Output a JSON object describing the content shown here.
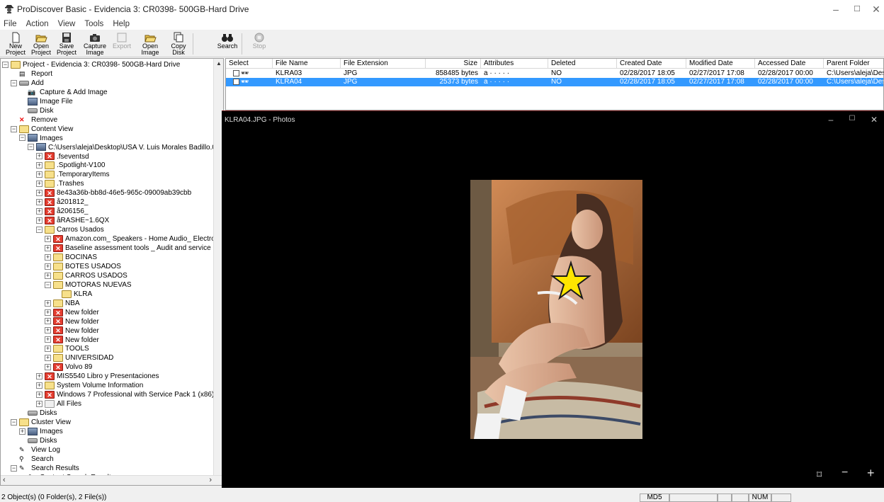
{
  "window": {
    "title": "ProDiscover Basic - Evidencia 3: CR0398- 500GB-Hard Drive",
    "controls": [
      "–",
      "☐",
      "✕"
    ]
  },
  "menu": [
    "File",
    "Action",
    "View",
    "Tools",
    "Help"
  ],
  "toolbar": {
    "buttons": [
      {
        "label": "New\nProject",
        "icon": "new-project-icon",
        "enabled": true
      },
      {
        "label": "Open\nProject",
        "icon": "open-project-icon",
        "enabled": true
      },
      {
        "label": "Save\nProject",
        "icon": "save-project-icon",
        "enabled": true
      },
      {
        "label": "Capture\nImage",
        "icon": "capture-image-icon",
        "enabled": true
      },
      {
        "label": "Export",
        "icon": "export-icon",
        "enabled": false
      },
      {
        "label": "Open\nImage",
        "icon": "open-image-icon",
        "enabled": true
      },
      {
        "label": "Copy\nDisk",
        "icon": "copy-disk-icon",
        "enabled": true
      },
      {
        "label": "Search",
        "icon": "binoculars-icon",
        "enabled": true
      },
      {
        "label": "Stop",
        "icon": "stop-icon",
        "enabled": false
      }
    ]
  },
  "tree": {
    "nodes": [
      {
        "label": "Project - Evidencia 3: CR0398- 500GB-Hard Drive",
        "icon": "folder",
        "level": 0,
        "exp": "-"
      },
      {
        "label": "Report",
        "icon": "report",
        "level": 1,
        "exp": ""
      },
      {
        "label": "Add",
        "icon": "disk",
        "level": 1,
        "exp": "-"
      },
      {
        "label": "Capture & Add Image",
        "icon": "camera",
        "level": 2,
        "exp": ""
      },
      {
        "label": "Image File",
        "icon": "image",
        "level": 2,
        "exp": ""
      },
      {
        "label": "Disk",
        "icon": "disk",
        "level": 2,
        "exp": ""
      },
      {
        "label": "Remove",
        "icon": "x",
        "level": 1,
        "exp": ""
      },
      {
        "label": "Content View",
        "icon": "folder",
        "level": 1,
        "exp": "-"
      },
      {
        "label": "Images",
        "icon": "image",
        "level": 2,
        "exp": "-"
      },
      {
        "label": "C:\\Users\\aleja\\Desktop\\USA V. Luis Morales Badillo.0",
        "icon": "image",
        "level": 3,
        "exp": "-"
      },
      {
        "label": ".fseventsd",
        "icon": "xfolder",
        "level": 4,
        "exp": "+"
      },
      {
        "label": ".Spotlight-V100",
        "icon": "folder",
        "level": 4,
        "exp": "+"
      },
      {
        "label": ".TemporaryItems",
        "icon": "folder",
        "level": 4,
        "exp": "+"
      },
      {
        "label": ".Trashes",
        "icon": "folder",
        "level": 4,
        "exp": "+"
      },
      {
        "label": "8e43a36b-bb8d-46e5-965c-09009ab39cbb",
        "icon": "xfolder",
        "level": 4,
        "exp": "+"
      },
      {
        "label": "å201812_",
        "icon": "xfolder",
        "level": 4,
        "exp": "+"
      },
      {
        "label": "å206156_",
        "icon": "xfolder",
        "level": 4,
        "exp": "+"
      },
      {
        "label": "åRASHE~1.6QX",
        "icon": "xfolder",
        "level": 4,
        "exp": "+"
      },
      {
        "label": "Carros Usados",
        "icon": "folder",
        "level": 4,
        "exp": "-"
      },
      {
        "label": "Amazon.com_ Speakers - Home Audio_ Electro",
        "icon": "xfolder",
        "level": 5,
        "exp": "+"
      },
      {
        "label": "Baseline assessment tools _ Audit and service i",
        "icon": "xfolder",
        "level": 5,
        "exp": "+"
      },
      {
        "label": "BOCINAS",
        "icon": "folder",
        "level": 5,
        "exp": "+"
      },
      {
        "label": "BOTES USADOS",
        "icon": "folder",
        "level": 5,
        "exp": "+"
      },
      {
        "label": "CARROS USADOS",
        "icon": "folder",
        "level": 5,
        "exp": "+"
      },
      {
        "label": "MOTORAS NUEVAS",
        "icon": "folder",
        "level": 5,
        "exp": "-"
      },
      {
        "label": "KLRA",
        "icon": "folder",
        "level": 6,
        "exp": ""
      },
      {
        "label": "NBA",
        "icon": "folder",
        "level": 5,
        "exp": "+"
      },
      {
        "label": "New folder",
        "icon": "xfolder",
        "level": 5,
        "exp": "+"
      },
      {
        "label": "New folder",
        "icon": "xfolder",
        "level": 5,
        "exp": "+"
      },
      {
        "label": "New folder",
        "icon": "xfolder",
        "level": 5,
        "exp": "+"
      },
      {
        "label": "New folder",
        "icon": "xfolder",
        "level": 5,
        "exp": "+"
      },
      {
        "label": "TOOLS",
        "icon": "folder",
        "level": 5,
        "exp": "+"
      },
      {
        "label": "UNIVERSIDAD",
        "icon": "folder",
        "level": 5,
        "exp": "+"
      },
      {
        "label": "Volvo 89",
        "icon": "xfolder",
        "level": 5,
        "exp": "+"
      },
      {
        "label": "MIS5540 Libro y Presentaciones",
        "icon": "xfolder",
        "level": 4,
        "exp": "+"
      },
      {
        "label": "System Volume Information",
        "icon": "folder",
        "level": 4,
        "exp": "+"
      },
      {
        "label": "Windows 7 Professional with Service Pack 1 (x86)",
        "icon": "xfolder",
        "level": 4,
        "exp": "+"
      },
      {
        "label": "All Files",
        "icon": "allfiles",
        "level": 4,
        "exp": "+"
      },
      {
        "label": "Disks",
        "icon": "disk",
        "level": 2,
        "exp": ""
      },
      {
        "label": "Cluster View",
        "icon": "folder",
        "level": 1,
        "exp": "-"
      },
      {
        "label": "Images",
        "icon": "image",
        "level": 2,
        "exp": "+"
      },
      {
        "label": "Disks",
        "icon": "disk",
        "level": 2,
        "exp": ""
      },
      {
        "label": "View Log",
        "icon": "log",
        "level": 1,
        "exp": ""
      },
      {
        "label": "Search",
        "icon": "binoculars",
        "level": 1,
        "exp": ""
      },
      {
        "label": "Search Results",
        "icon": "log",
        "level": 1,
        "exp": "-"
      },
      {
        "label": "Content Search Results",
        "icon": "binoculars",
        "level": 2,
        "exp": ""
      }
    ]
  },
  "filelist": {
    "columns": [
      "Select",
      "File Name",
      "File Extension",
      "Size",
      "Attributes",
      "Deleted",
      "Created Date",
      "Modified Date",
      "Accessed Date",
      "Parent Folder"
    ],
    "rows": [
      {
        "name": "KLRA03",
        "ext": "JPG",
        "size": "858485 bytes",
        "attr": "a · · · · ·",
        "deleted": "NO",
        "created": "02/28/2017 18:05",
        "modified": "02/27/2017 17:08",
        "accessed": "02/28/2017 00:00",
        "parent": "C:\\Users\\aleja\\Desk",
        "selected": false
      },
      {
        "name": "KLRA04",
        "ext": "JPG",
        "size": "25373 bytes",
        "attr": "a · · · · ·",
        "deleted": "NO",
        "created": "02/28/2017 18:05",
        "modified": "02/27/2017 17:08",
        "accessed": "02/28/2017 00:00",
        "parent": "C:\\Users\\aleja\\Desk",
        "selected": true
      }
    ]
  },
  "photos": {
    "title": "KLRA04.JPG - Photos",
    "controls": [
      "–",
      "☐",
      "✕"
    ],
    "zoom_controls": [
      "⌑",
      "−",
      "+"
    ]
  },
  "statusbar": {
    "text": "2 Object(s) (0 Folder(s), 2 File(s))",
    "panels": [
      "MD5",
      "",
      "",
      "",
      "NUM",
      ""
    ]
  },
  "colors": {
    "selection": "#3399ff",
    "folder": "#f7e08a",
    "deleted_folder": "#e53d30",
    "star": "#ffe600"
  }
}
